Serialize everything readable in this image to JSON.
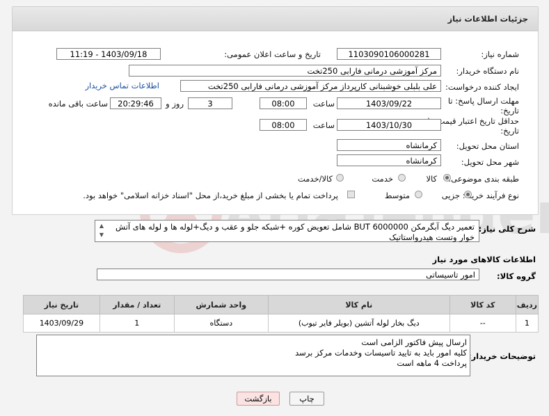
{
  "header": {
    "title": "جزئیات اطلاعات نیاز"
  },
  "fields": {
    "need_number_label": "شماره نیاز:",
    "need_number": "1103090106000281",
    "announce_label": "تاریخ و ساعت اعلان عمومی:",
    "announce_value": "1403/09/18 - 11:19",
    "buyer_label": "نام دستگاه خریدار:",
    "buyer_value": "مرکز آموزشی  درمانی فارابی 250تخت",
    "creator_label": "ایجاد کننده درخواست:",
    "creator_value": "علی بلبلی خوشبنانی کارپرداز مرکز آموزشی  درمانی فارابی 250تخت",
    "contact_link": "اطلاعات تماس خریدار",
    "deadline_label": "مهلت ارسال پاسخ: تا تاریخ:",
    "deadline_date": "1403/09/22",
    "time_label": "ساعت",
    "deadline_time": "08:00",
    "days_value": "3",
    "days_label": "روز و",
    "remaining_time": "20:29:46",
    "remaining_label": "ساعت باقی مانده",
    "validity_label": "حداقل تاریخ اعتبار قیمت: تا تاریخ:",
    "validity_date": "1403/10/30",
    "validity_time": "08:00",
    "province_label": "استان محل تحویل:",
    "province_value": "کرمانشاه",
    "city_label": "شهر محل تحویل:",
    "city_value": "کرمانشاه",
    "category_label": "طبقه بندی موضوعی:",
    "category_options": [
      "کالا",
      "خدمت",
      "کالا/خدمت"
    ],
    "purchase_label": "نوع فرآیند خرید :",
    "purchase_options": [
      "جزیی",
      "متوسط"
    ],
    "payment_note": "پرداخت تمام یا بخشی از مبلغ خرید،از محل \"اسناد خزانه اسلامی\" خواهد بود."
  },
  "description": {
    "label": "شرح کلی نیاز:",
    "text": "تعمیر دیگ آبگرمکن BUT 6000000 شامل تعویض کوره +شبکه جلو و عقب و دیگ+لوله ها و لوله های آتش خوار وتست هیدرواستاتیک"
  },
  "goods": {
    "section_title": "اطلاعات کالاهای مورد نیاز",
    "group_label": "گروه کالا:",
    "group_value": "امور تاسیساتی",
    "columns": [
      "ردیف",
      "کد کالا",
      "نام کالا",
      "واحد شمارش",
      "تعداد / مقدار",
      "تاریخ نیاز"
    ],
    "rows": [
      [
        "1",
        "--",
        "دیگ بخار لوله آتشین (بویلر فایر تیوب)",
        "دستگاه",
        "1",
        "1403/09/29"
      ]
    ]
  },
  "buyer_notes": {
    "label": "توضیحات خریدار:",
    "lines": [
      "ارسال پیش فاکتور الزامی است",
      "کلیه امور باید به تایید تاسیسات وخدمات مرکز برسد",
      "پرداخت 4 ماهه است"
    ]
  },
  "buttons": {
    "print": "چاپ",
    "back": "بازگشت"
  },
  "watermark": {
    "text": "AriaTender.neT"
  }
}
